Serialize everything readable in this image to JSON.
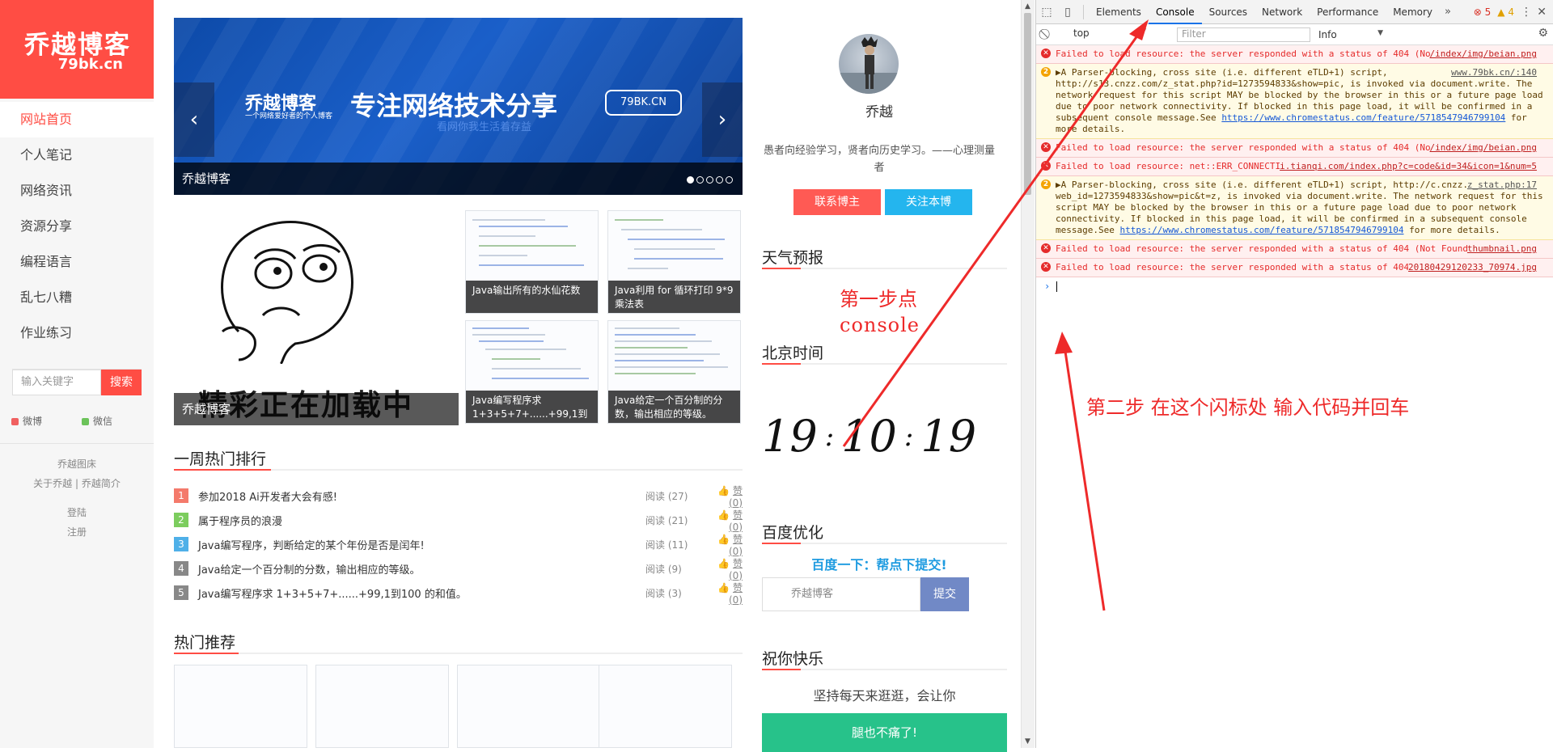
{
  "sidebar": {
    "logo_title": "乔越博客",
    "logo_domain": "79bk.cn",
    "nav": [
      "网站首页",
      "个人笔记",
      "网络资讯",
      "资源分享",
      "编程语言",
      "乱七八糟",
      "作业练习"
    ],
    "search_placeholder": "输入关键字",
    "search_button": "搜索",
    "social": [
      "微博",
      "微信"
    ],
    "links": [
      "乔越图床",
      "关于乔越",
      "乔越简介",
      "登陆",
      "注册"
    ]
  },
  "banner": {
    "brand": "乔越博客",
    "brand_sub": "一个网络爱好者的个人博客",
    "slogan": "专注网络技术分享",
    "ghost_text": "看网你我生活着存益",
    "badge": "79BK.CN",
    "caption": "乔越博客",
    "dots": 5,
    "active_dot": 0
  },
  "featured": {
    "big_text": "精彩正在加载中",
    "caption": "乔越博客"
  },
  "thumbs": [
    {
      "caption": "Java输出所有的水仙花数"
    },
    {
      "caption": "Java利用 for 循环打印 9*9 乘法表"
    },
    {
      "caption": "Java编写程序求 1+3+5+7+......+99,1到"
    },
    {
      "caption": "Java给定一个百分制的分数，输出相应的等级。"
    }
  ],
  "hot": {
    "title": "一周热门排行",
    "items": [
      {
        "num": "1",
        "title": "参加2018 Ai开发者大会有感!",
        "read": "阅读 (27)",
        "like": "赞 (0)",
        "color": "#f47a6b"
      },
      {
        "num": "2",
        "title": "属于程序员的浪漫",
        "read": "阅读 (21)",
        "like": "赞 (0)",
        "color": "#7ccd5e"
      },
      {
        "num": "3",
        "title": "Java编写程序，判断给定的某个年份是否是闰年!",
        "read": "阅读 (11)",
        "like": "赞 (0)",
        "color": "#4fb0e8"
      },
      {
        "num": "4",
        "title": "Java给定一个百分制的分数，输出相应的等级。",
        "read": "阅读 (9)",
        "like": "赞 (0)",
        "color": "#888888"
      },
      {
        "num": "5",
        "title": "Java编写程序求 1+3+5+7+......+99,1到100 的和值。",
        "read": "阅读 (3)",
        "like": "赞 (0)",
        "color": "#888888"
      }
    ]
  },
  "recommend": {
    "title": "热门推荐"
  },
  "profile": {
    "name": "乔越",
    "quote": "愚者向经验学习，贤者向历史学习。——心理测量者",
    "contact_btn": "联系博主",
    "follow_btn": "关注本博"
  },
  "weather": {
    "title": "天气预报"
  },
  "beijing_time": {
    "title": "北京时间",
    "h": "19",
    "m": "10",
    "s": "19"
  },
  "baidu": {
    "title": "百度优化",
    "cta": "百度一下：帮点下提交!",
    "input_value": "乔越博客",
    "submit": "提交"
  },
  "wish": {
    "title": "祝你快乐",
    "text": "坚持每天来逛逛，会让你",
    "button": "腿也不痛了!"
  },
  "annotations": {
    "step1_line1": "第一步点",
    "step1_line2": "console",
    "step2": "第二步  在这个闪标处  输入代码并回车",
    "color": "#ee2a2a"
  },
  "devtools": {
    "tabs": [
      "Elements",
      "Console",
      "Sources",
      "Network",
      "Performance",
      "Memory"
    ],
    "active_tab": "Console",
    "more": "»",
    "errors": "5",
    "warnings": "4",
    "context": "top",
    "filter_placeholder": "Filter",
    "levels": "Info",
    "messages": [
      {
        "type": "err",
        "text": "Failed to load resource: the server responded with a status of 404 (Not Found)",
        "src": "/index/img/beian.png"
      },
      {
        "type": "warn",
        "count": "2",
        "text": "▶A Parser-blocking, cross site (i.e. different eTLD+1) script, http://s13.cnzz.com/z_stat.php?id=1273594833&show=pic, is invoked via document.write. The network request for this script MAY be blocked by the browser in this or a future page load due to poor network connectivity. If blocked in this page load, it will be confirmed in a subsequent console message.See",
        "link": "https://www.chromestatus.com/feature/5718547946799104",
        "tail": " for more details.",
        "src": "www.79bk.cn/:140"
      },
      {
        "type": "err",
        "text": "Failed to load resource: the server responded with a status of 404 (Not Found)",
        "src": "/index/img/beian.png"
      },
      {
        "type": "err",
        "text": "Failed to load resource: net::ERR_CONNECTION_RESET",
        "src": "i.tianqi.com/index.php?c=code&id=34&icon=1&num=5"
      },
      {
        "type": "warn",
        "count": "2",
        "text": "▶A Parser-blocking, cross site (i.e. different eTLD+1) script, http://c.cnzz.com/core.php?web_id=1273594833&show=pic&t=z, is invoked via document.write. The network request for this script MAY be blocked by the browser in this or a future page load due to poor network connectivity. If blocked in this page load, it will be confirmed in a subsequent console message.See",
        "link": "https://www.chromestatus.com/feature/5718547946799104",
        "tail": " for more details.",
        "src": "z_stat.php:17"
      },
      {
        "type": "err",
        "text": "Failed to load resource: the server responded with a status of 404 (Not Found)",
        "src": "thumbnail.png"
      },
      {
        "type": "err",
        "text": "Failed to load resource: the server responded with a status of 404 (Not Found)",
        "src": "20180429120233_70974.jpg"
      }
    ],
    "prompt": "›"
  }
}
